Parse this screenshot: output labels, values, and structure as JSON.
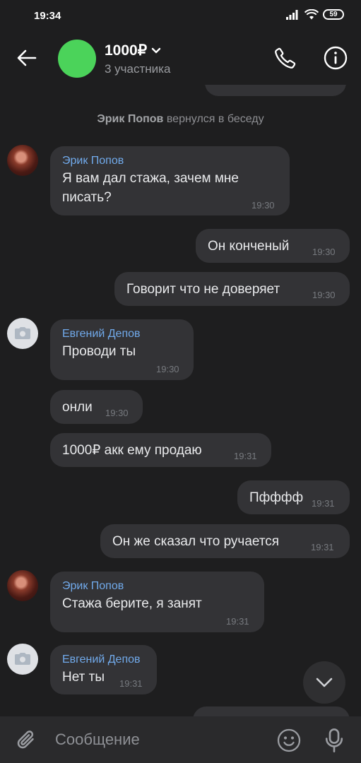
{
  "status_bar": {
    "time": "19:34",
    "battery": "59"
  },
  "header": {
    "title": "1000₽",
    "subtitle": "3 участника"
  },
  "service_message": {
    "name": "Эрик Попов",
    "text": "вернулся в беседу"
  },
  "messages": [
    {
      "author": "Эрик Попов",
      "text": "Я вам дал стажа, зачем мне",
      "text2": "писать?",
      "time": "19:30"
    },
    {
      "text": "Он конченый",
      "time": "19:30"
    },
    {
      "text": "Говорит что не доверяет",
      "time": "19:30"
    },
    {
      "author": "Евгений Депов",
      "text": "Проводи ты",
      "time": "19:30"
    },
    {
      "text": "онли",
      "time": "19:30"
    },
    {
      "text": "1000₽ акк ему продаю",
      "time": "19:31"
    },
    {
      "text": "Пфффф",
      "time": "19:31"
    },
    {
      "text": "Он же сказал что ручается",
      "time": "19:31"
    },
    {
      "author": "Эрик Попов",
      "text": "Стажа берите, я занят",
      "time": "19:31"
    },
    {
      "author": "Евгений Депов",
      "text": "Нет ты",
      "time": "19:31"
    }
  ],
  "composer": {
    "placeholder": "Сообщение"
  }
}
